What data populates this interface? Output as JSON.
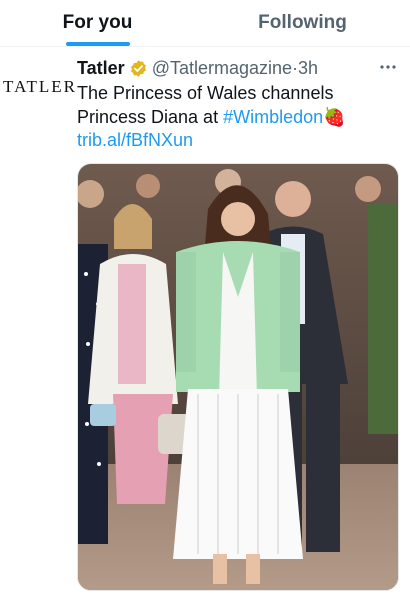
{
  "tabs": {
    "for_you": "For you",
    "following": "Following"
  },
  "tweet": {
    "avatar_text": "TATLER",
    "author": "Tatler",
    "handle": "@Tatlermagazine",
    "separator": "·",
    "time": "3h",
    "text_line1": "The Princess of Wales channels",
    "text_line2": "Princess Diana at",
    "hashtag": "#Wimbledon",
    "emoji": "🍓",
    "link": "trib.al/fBfNXun",
    "icons": {
      "verified": "verified-gold-badge-icon",
      "more": "more-horizontal-icon"
    }
  },
  "colors": {
    "accent": "#1d9bf0",
    "verified_gold": "#e2b719",
    "secondary_text": "#536471"
  }
}
